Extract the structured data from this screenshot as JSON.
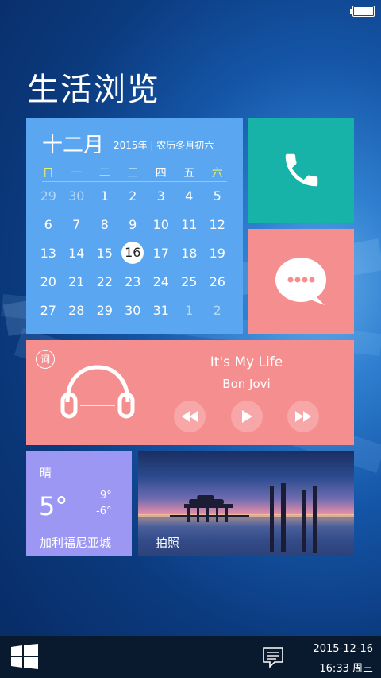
{
  "page_title": "生活浏览",
  "calendar": {
    "month": "十二月",
    "subtitle": "2015年 | 农历冬月初六",
    "weekdays": [
      "日",
      "一",
      "二",
      "三",
      "四",
      "五",
      "六"
    ],
    "weeks": [
      [
        "29",
        "30",
        "1",
        "2",
        "3",
        "4",
        "5"
      ],
      [
        "6",
        "7",
        "8",
        "9",
        "10",
        "11",
        "12"
      ],
      [
        "13",
        "14",
        "15",
        "16",
        "17",
        "18",
        "19"
      ],
      [
        "20",
        "21",
        "22",
        "23",
        "24",
        "25",
        "26"
      ],
      [
        "27",
        "28",
        "29",
        "30",
        "31",
        "1",
        "2"
      ]
    ],
    "today": "16"
  },
  "music": {
    "lyric_badge": "词",
    "title": "It's My Life",
    "artist": "Bon Jovi"
  },
  "weather": {
    "condition": "晴",
    "temperature": "5°",
    "high": "9°",
    "low": "-6°",
    "city": "加利福尼亚城"
  },
  "photo": {
    "label": "拍照"
  },
  "taskbar": {
    "date": "2015-12-16",
    "time": "16:33 周三"
  },
  "colors": {
    "calendar": "#5aa6f0",
    "phone": "#17b3a8",
    "message": "#f58f8f",
    "music": "#f58f8f",
    "weather": "#9c97f2",
    "taskbar": "#0a1a2e"
  },
  "icons": {
    "phone": "phone-icon",
    "message": "chat-bubble-icon",
    "music": "headphones-icon",
    "start": "windows-logo-icon",
    "notifications": "action-center-icon"
  }
}
